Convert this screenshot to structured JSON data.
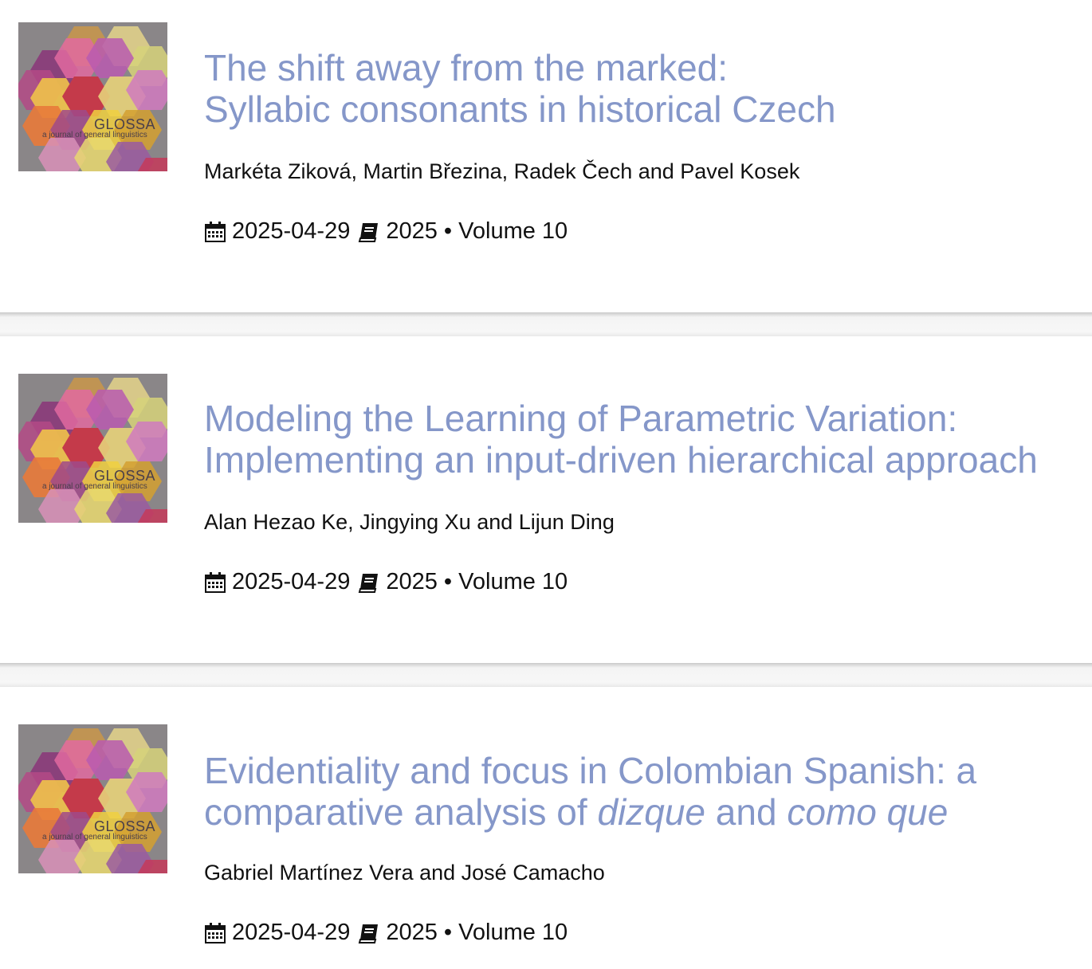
{
  "cover": {
    "title": "GLOSSA",
    "subtitle": "a journal of general linguistics"
  },
  "articles": [
    {
      "title_line1": "The shift away from the marked:",
      "title_line2": "Syllabic consonants in historical Czech",
      "authors": "Markéta Ziková, Martin Březina, Radek Čech and Pavel Kosek",
      "date": "2025-04-29",
      "year": "2025",
      "volume_sep": "•",
      "volume": "Volume 10"
    },
    {
      "title_line1": "Modeling the Learning of Parametric Variation:",
      "title_line2": "Implementing an input-driven hierarchical approach",
      "authors": "Alan Hezao Ke, Jingying Xu and Lijun Ding",
      "date": "2025-04-29",
      "year": "2025",
      "volume_sep": "•",
      "volume": "Volume 10"
    },
    {
      "title_line1": "Evidentiality and focus in Colombian Spanish: a",
      "title_line2_pre": "comparative analysis of ",
      "title_line2_em1": "dizque",
      "title_line2_mid": " and ",
      "title_line2_em2": "como que",
      "authors": "Gabriel Martínez Vera and José Camacho",
      "date": "2025-04-29",
      "year": "2025",
      "volume_sep": "•",
      "volume": "Volume 10"
    }
  ],
  "icons": {
    "date": "calendar-icon",
    "issue": "book-icon"
  },
  "colors": {
    "title": "#8597c9",
    "text": "#111111",
    "cover_bg": "#8a8688"
  }
}
